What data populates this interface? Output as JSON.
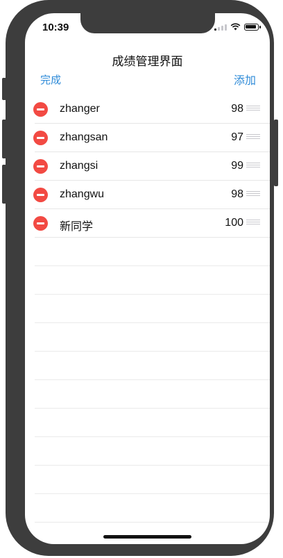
{
  "status_bar": {
    "time": "10:39",
    "icons": [
      "signal-icon",
      "wifi-icon",
      "battery-icon"
    ]
  },
  "nav": {
    "title": "成绩管理界面",
    "left_button": "完成",
    "right_button": "添加",
    "accent_color": "#2f8bd8"
  },
  "students": [
    {
      "name": "zhanger",
      "score": "98"
    },
    {
      "name": "zhangsan",
      "score": "97"
    },
    {
      "name": "zhangsi",
      "score": "99"
    },
    {
      "name": "zhangwu",
      "score": "98"
    },
    {
      "name": "新同学",
      "score": "100"
    }
  ],
  "delete_color": "#f24a43"
}
